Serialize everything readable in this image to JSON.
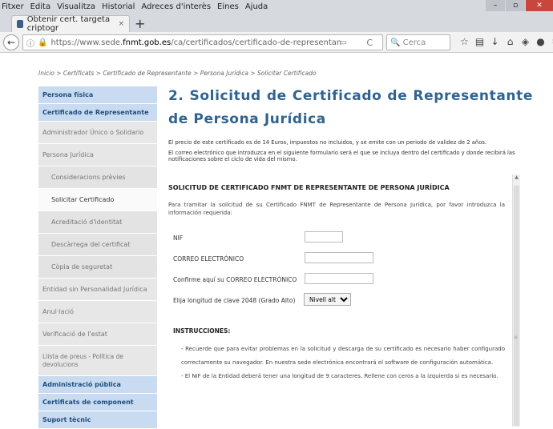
{
  "menu": [
    "Fitxer",
    "Edita",
    "Visualitza",
    "Historial",
    "Adreces d'interès",
    "Eines",
    "Ajuda"
  ],
  "tab": {
    "title": "Obtenir cert. targeta criptogr",
    "close": "×",
    "new": "+"
  },
  "url": {
    "prefix": "https://www.sede.",
    "domain": "fnmt.gob.es",
    "path": "/ca/certificados/certificado-de-representan"
  },
  "search": {
    "placeholder": "Cerca"
  },
  "breadcrumb": "Inicio > Certificats > Certificado de Representante > Persona Jurídica > Solicitar Certificado",
  "sidebar": {
    "items": [
      {
        "label": "Persona física",
        "style": "blue"
      },
      {
        "label": "Certificado de Representante",
        "style": "blue"
      },
      {
        "label": "Administrador Único o Solidario",
        "style": "grey"
      },
      {
        "label": "Persona Jurídica",
        "style": "grey"
      },
      {
        "label": "Consideracions prèvies",
        "style": "sub"
      },
      {
        "label": "Solicitar Certificado",
        "style": "sub-active"
      },
      {
        "label": "Acreditació d'identitat",
        "style": "sub"
      },
      {
        "label": "Descàrrega del certificat",
        "style": "sub"
      },
      {
        "label": "Còpia de seguretat",
        "style": "sub"
      },
      {
        "label": "Entidad sin Personalidad Jurídica",
        "style": "grey"
      },
      {
        "label": "Anul·lació",
        "style": "grey"
      },
      {
        "label": "Verificació de l'estat",
        "style": "grey"
      },
      {
        "label": "Llista de preus - Política de devolucions",
        "style": "grey2"
      },
      {
        "label": "Administració pública",
        "style": "blue"
      },
      {
        "label": "Certificats de component",
        "style": "blue"
      },
      {
        "label": "Suport tècnic",
        "style": "blue"
      }
    ]
  },
  "main": {
    "title": "2. Solicitud de Certificado de Representante de Persona Jurídica",
    "intro1": "El precio de este certificado es de 14 Euros, impuestos no incluidos, y se emite con un periodo de validez de 2 años.",
    "intro2": "El correo electrónico que introduzca en el siguiente formulario será el que se incluya dentro del certificado y donde recibirá las notificaciones sobre el ciclo de vida del mismo."
  },
  "form": {
    "heading": "SOLICITUD DE CERTIFICADO FNMT DE REPRESENTANTE DE PERSONA JURÍDICA",
    "description": "Para tramitar la solicitud de su Certificado FNMT de Representante de Persona Jurídica, por favor introduzca la información requerida:",
    "nif_label": "NIF",
    "nif_value": "",
    "email_label": "CORREO ELECTRÓNICO",
    "email_value": "",
    "confirm_label": "Confirme aquí su CORREO ELECTRÓNICO",
    "confirm_value": "",
    "keylen_label": "Elija longitud de clave  2048  (Grado Alto)",
    "keylen_selected": "Nivell alt",
    "instructions_heading": "INSTRUCCIONES:",
    "instructions": [
      "- Recuerde que para evitar problemas en la solicitud y descarga de su certificado es necesario haber configurado correctamente su navegador. En nuestra sede electrónica encontrará el software de configuración automática.",
      "- El NIF de la Entidad deberá tener una longitud de 9 caracteres. Rellene con ceros a la izquierda si es necesario."
    ]
  },
  "colors": {
    "title": "#2f6390",
    "sidebar_blue": "#c8dbf0",
    "sidebar_grey": "#e7e7e7",
    "secure": "#2c9b38"
  }
}
